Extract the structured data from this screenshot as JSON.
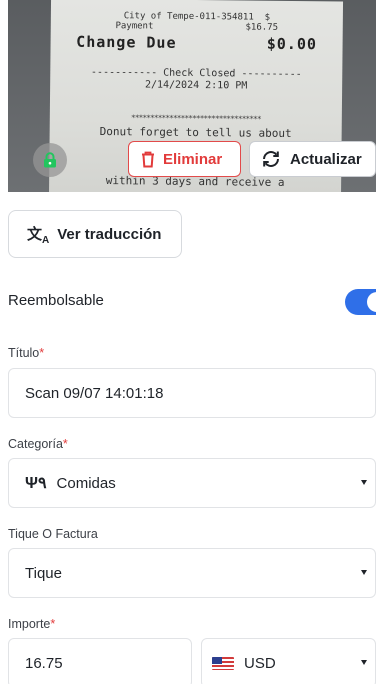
{
  "receipt": {
    "lines": [
      "City of Tempe-011-354811  $",
      "Payment                 $16.75",
      "Change Due         $0.00",
      "----------- Check Closed ----------",
      "2/14/2024 2:10 PM",
      "**********************************",
      "Donut forget to tell us about",
      "to",
      "within 3 days and receive a",
      ""
    ]
  },
  "actions": {
    "delete_label": "Eliminar",
    "update_label": "Actualizar"
  },
  "translation": {
    "label": "Ver traducción"
  },
  "reimbursable": {
    "label": "Reembolsable",
    "enabled": true,
    "accent": "#2f6fe8"
  },
  "title_field": {
    "label": "Título",
    "required_mark": "*",
    "value": "Scan 09/07 14:01:18"
  },
  "category_field": {
    "label": "Categoría",
    "required_mark": "*",
    "icon": "utensils-icon",
    "value": "Comidas"
  },
  "receipt_type_field": {
    "label": "Tique O Factura",
    "value": "Tique"
  },
  "amount_field": {
    "label": "Importe",
    "required_mark": "*",
    "value": "16.75",
    "currency": "USD",
    "currency_flag": "us-flag-icon"
  }
}
